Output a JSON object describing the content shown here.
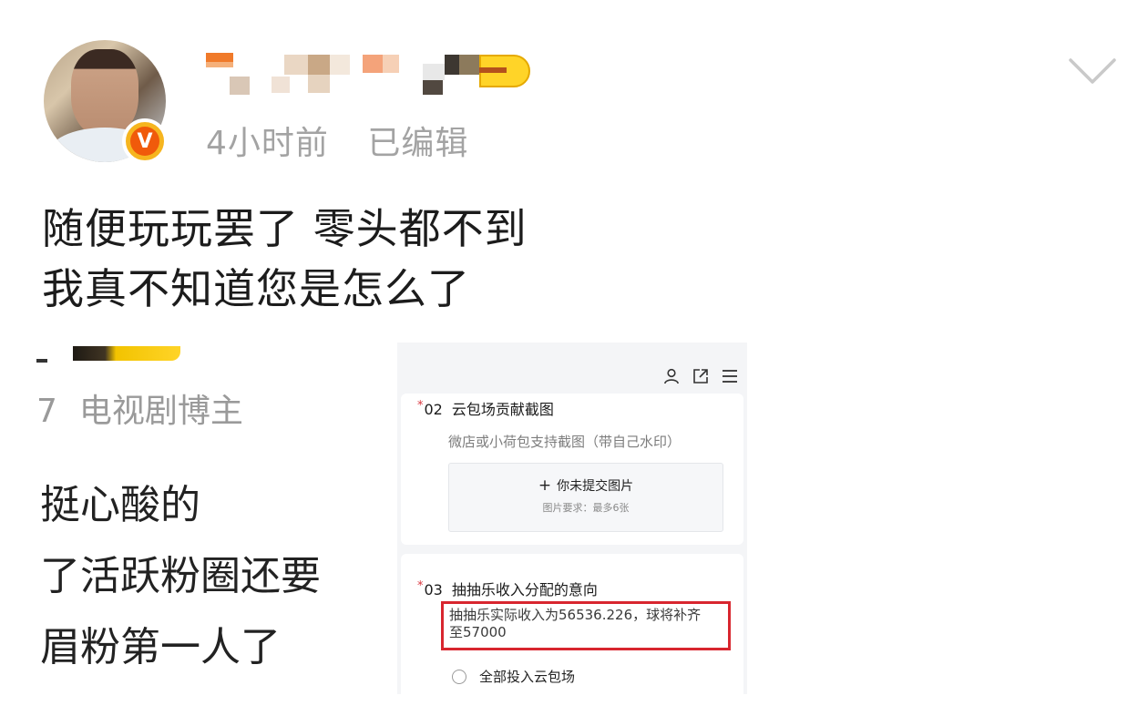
{
  "post": {
    "time": "4小时前",
    "edited": "已编辑",
    "verified_badge": "V",
    "lines": [
      "随便玩玩罢了 零头都不到",
      "我真不知道您是怎么了"
    ]
  },
  "embedded_post": {
    "role_prefix": "7",
    "role": "电视剧博主",
    "lines": [
      "挺心酸的",
      "了活跃粉圈还要",
      "眉粉第一人了"
    ]
  },
  "form": {
    "q2": {
      "star": "*",
      "num": "02",
      "title": "云包场贡献截图",
      "hint": "微店或小荷包支持截图（带自己水印）",
      "upload_label": "你未提交图片",
      "upload_requirement": "图片要求：最多6张"
    },
    "q3": {
      "star": "*",
      "num": "03",
      "title": "抽抽乐收入分配的意向",
      "highlight_line1": "抽抽乐实际收入为56536.226，球将补齐",
      "highlight_line2": "至57000",
      "option1": "全部投入云包场"
    }
  },
  "icons": {
    "menu": "chevron-down-icon",
    "form_icons": [
      "user-icon",
      "share-icon",
      "menu-icon"
    ]
  },
  "colors": {
    "accent_red": "#d8262f",
    "badge_orange": "#f05a0b",
    "badge_yellow": "#f6b51f",
    "meta_gray": "#a3a3a3"
  }
}
